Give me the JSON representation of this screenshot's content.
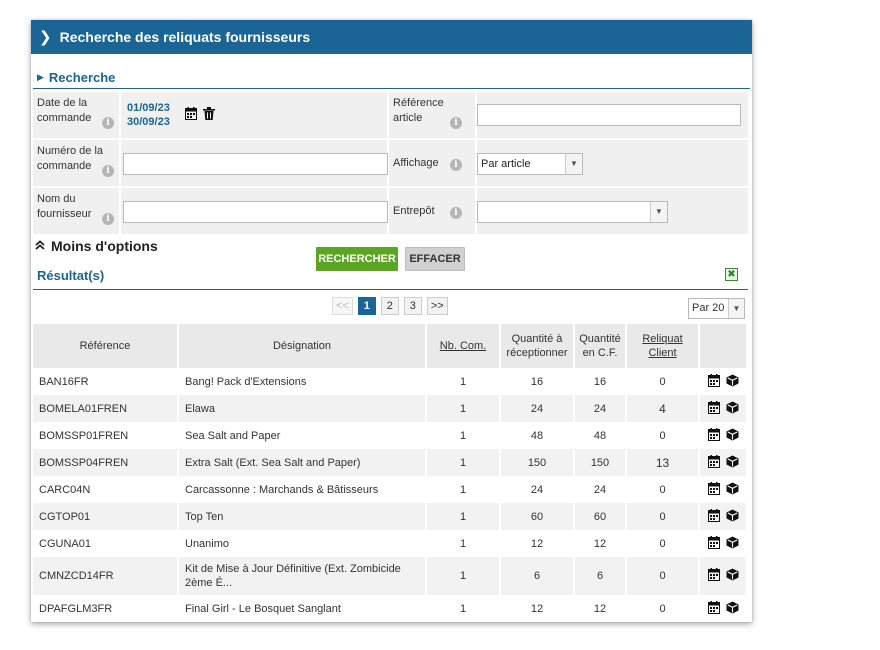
{
  "header": {
    "title": "Recherche des reliquats fournisseurs"
  },
  "search_section": {
    "title": "Recherche"
  },
  "form": {
    "order_date": {
      "label": "Date de la commande",
      "from": "01/09/23",
      "to": "30/09/23"
    },
    "article_ref": {
      "label": "Référence article",
      "value": ""
    },
    "order_number": {
      "label": "Numéro de la commande",
      "value": ""
    },
    "display": {
      "label": "Affichage",
      "selected": "Par article"
    },
    "supplier_name": {
      "label": "Nom du fournisseur",
      "value": ""
    },
    "warehouse": {
      "label": "Entrepôt",
      "selected": ""
    }
  },
  "options": {
    "label": "Moins d'options"
  },
  "buttons": {
    "search": "RECHERCHER",
    "clear": "EFFACER"
  },
  "results": {
    "title": "Résultat(s)"
  },
  "pagination": {
    "prev": "<<",
    "pages": [
      "1",
      "2",
      "3"
    ],
    "current": "1",
    "next": ">>"
  },
  "per_page": {
    "selected": "Par 20"
  },
  "table": {
    "columns": [
      "Référence",
      "Désignation",
      "Nb. Com.",
      "Quantité à réceptionner",
      "Quantité en C.F.",
      "Reliquat Client"
    ],
    "rows": [
      {
        "ref": "BAN16FR",
        "designation": "Bang! Pack d'Extensions",
        "nb_com": "1",
        "qty_recv": "16",
        "qty_cf": "16",
        "reliquat": "0"
      },
      {
        "ref": "BOMELA01FREN",
        "designation": "Elawa",
        "nb_com": "1",
        "qty_recv": "24",
        "qty_cf": "24",
        "reliquat": "4"
      },
      {
        "ref": "BOMSSP01FREN",
        "designation": "Sea Salt and Paper",
        "nb_com": "1",
        "qty_recv": "48",
        "qty_cf": "48",
        "reliquat": "0"
      },
      {
        "ref": "BOMSSP04FREN",
        "designation": "Extra Salt (Ext. Sea Salt and Paper)",
        "nb_com": "1",
        "qty_recv": "150",
        "qty_cf": "150",
        "reliquat": "13"
      },
      {
        "ref": "CARC04N",
        "designation": "Carcassonne : Marchands & Bâtisseurs",
        "nb_com": "1",
        "qty_recv": "24",
        "qty_cf": "24",
        "reliquat": "0"
      },
      {
        "ref": "CGTOP01",
        "designation": "Top Ten",
        "nb_com": "1",
        "qty_recv": "60",
        "qty_cf": "60",
        "reliquat": "0"
      },
      {
        "ref": "CGUNA01",
        "designation": "Unanimo",
        "nb_com": "1",
        "qty_recv": "12",
        "qty_cf": "12",
        "reliquat": "0"
      },
      {
        "ref": "CMNZCD14FR",
        "designation": "Kit de Mise à Jour Définitive (Ext. Zombicide 2ème É...",
        "nb_com": "1",
        "qty_recv": "6",
        "qty_cf": "6",
        "reliquat": "0"
      },
      {
        "ref": "DPAFGLM3FR",
        "designation": "Final Girl - Le Bosquet Sanglant",
        "nb_com": "1",
        "qty_recv": "12",
        "qty_cf": "12",
        "reliquat": "0"
      }
    ],
    "row_actions": [
      "calendar-icon",
      "box-icon"
    ]
  },
  "colors": {
    "primary": "#1a6496",
    "search_button": "#5aa620"
  }
}
